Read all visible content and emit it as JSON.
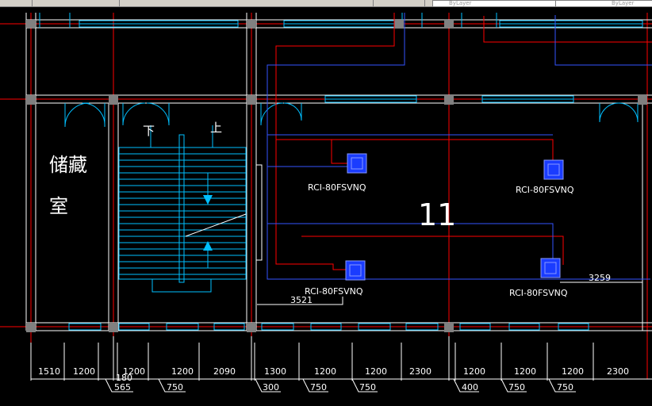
{
  "toolbar": {
    "layer_combo_left": "ByLayer",
    "layer_combo_right": "ByLayer"
  },
  "room": {
    "storage_line1": "储藏",
    "storage_line2": "室",
    "room_number": "11",
    "stair_down": "下",
    "stair_up": "上"
  },
  "units": [
    {
      "label": "RCI-80FSVNQ"
    },
    {
      "label": "RCI-80FSVNQ"
    },
    {
      "label": "RCI-80FSVNQ"
    },
    {
      "label": "RCI-80FSVNQ"
    }
  ],
  "callouts": {
    "upper_right": "3259",
    "lower_left": "3521"
  },
  "dimensions_top_row": [
    "1510",
    "1200",
    "1200",
    "1200",
    "2090",
    "1300",
    "1200",
    "1200",
    "2300",
    "1200",
    "1200",
    "1200",
    "2300"
  ],
  "dimensions_bottom_row": [
    "180",
    "565",
    "750",
    "300",
    "750",
    "750",
    "400",
    "750",
    "750"
  ],
  "colors": {
    "wall": "#ffffff",
    "red_line": "#ff0000",
    "blue_line": "#3355ff",
    "cyan_line": "#00bfff",
    "unit_fill": "#1a3cff",
    "column": "#808080"
  }
}
